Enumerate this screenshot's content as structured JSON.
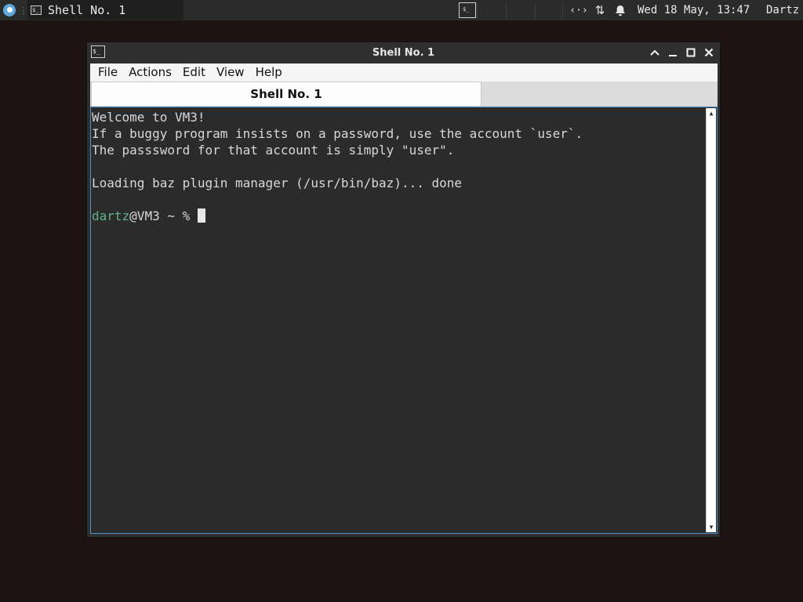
{
  "panel": {
    "task_separator": "⋮",
    "taskbar_item_label": "Shell No. 1",
    "taskbar_item_icon": "terminal-icon",
    "desktop_switch_icon": "terminal-icon",
    "tray_net": "‹·›",
    "tray_updown": "⇅",
    "clock": "Wed 18 May, 13:47",
    "user": "Dartz"
  },
  "window": {
    "title": "Shell No. 1",
    "icon": "terminal-icon",
    "buttons": {
      "shade": "⌃",
      "minimize": "—",
      "maximize": "□",
      "close": "✕"
    }
  },
  "menubar": {
    "items": [
      "File",
      "Actions",
      "Edit",
      "View",
      "Help"
    ]
  },
  "tabs": [
    {
      "label": "Shell No. 1",
      "active": true
    }
  ],
  "terminal": {
    "lines": [
      "Welcome to VM3!",
      "If a buggy program insists on a password, use the account `user`.",
      "The passsword for that account is simply \"user\".",
      "",
      "Loading baz plugin manager (/usr/bin/baz)... done",
      ""
    ],
    "prompt_user": "dartz",
    "prompt_rest": "@VM3 ~ % ",
    "colors": {
      "background": "#2b2b2b",
      "foreground": "#d8d8d8",
      "prompt_user": "#61b08a",
      "focus_border": "#4a93c9"
    }
  }
}
